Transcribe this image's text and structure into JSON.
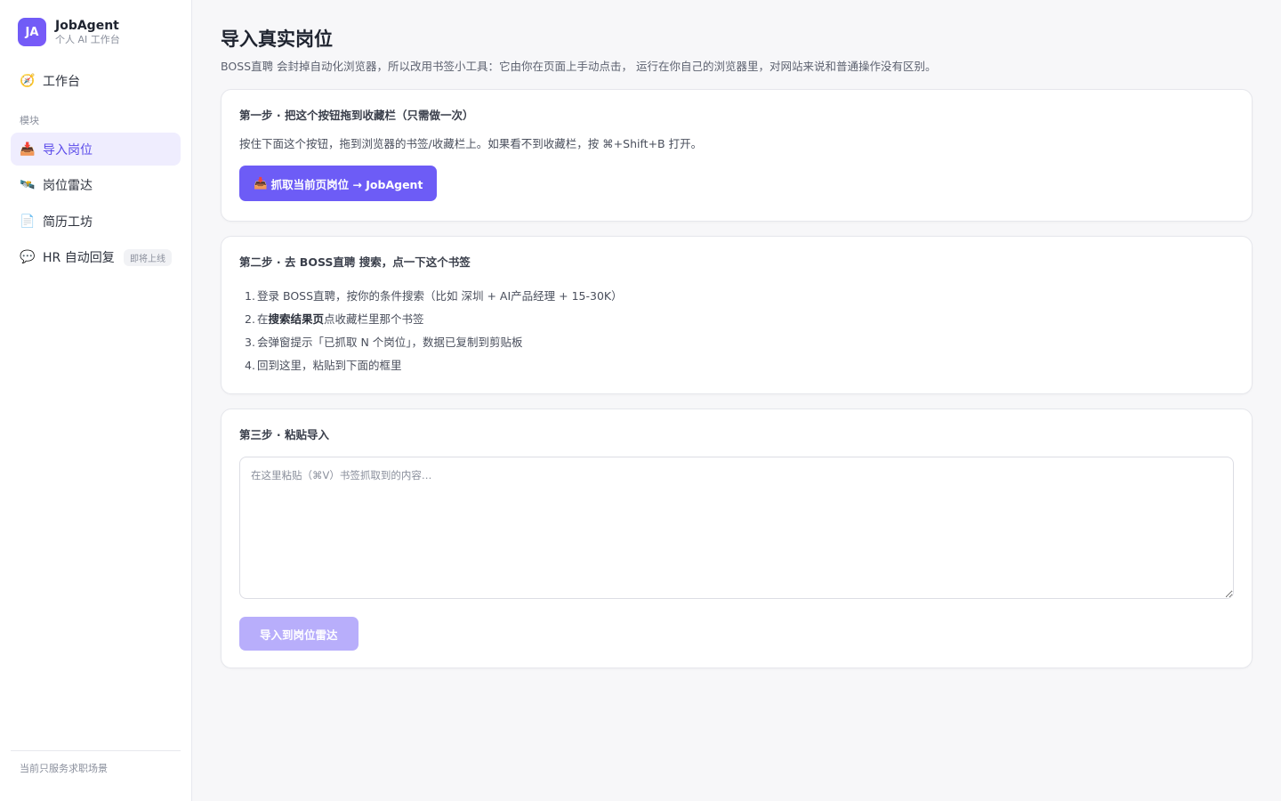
{
  "brand": {
    "logo": "JA",
    "name": "JobAgent",
    "subtitle": "个人 AI 工作台"
  },
  "nav": {
    "home": {
      "icon": "🧭",
      "label": "工作台"
    },
    "section_label": "模块",
    "items": [
      {
        "icon": "📥",
        "label": "导入岗位",
        "active": true
      },
      {
        "icon": "🛰️",
        "label": "岗位雷达"
      },
      {
        "icon": "📄",
        "label": "简历工坊"
      },
      {
        "icon": "💬",
        "label": "HR 自动回复",
        "badge": "即将上线"
      }
    ]
  },
  "sidebar_footer": "当前只服务求职场景",
  "page": {
    "title": "导入真实岗位",
    "description": "BOSS直聘 会封掉自动化浏览器，所以改用书签小工具：它由你在页面上手动点击， 运行在你自己的浏览器里，对网站来说和普通操作没有区别。"
  },
  "step1": {
    "title": "第一步 · 把这个按钮拖到收藏栏（只需做一次）",
    "text": "按住下面这个按钮，拖到浏览器的书签/收藏栏上。如果看不到收藏栏，按 ⌘+Shift+B 打开。",
    "button_icon": "📥",
    "button_label": "抓取当前页岗位 → JobAgent"
  },
  "step2": {
    "title": "第二步 · 去 BOSS直聘 搜索，点一下这个书签",
    "items": [
      {
        "num": "1.",
        "pre": "登录 BOSS直聘，按你的条件搜索（比如 深圳 + AI产品经理 + 15-30K）",
        "bold": "",
        "post": ""
      },
      {
        "num": "2.",
        "pre": "在",
        "bold": "搜索结果页",
        "post": "点收藏栏里那个书签"
      },
      {
        "num": "3.",
        "pre": "会弹窗提示「已抓取 N 个岗位」，数据已复制到剪贴板",
        "bold": "",
        "post": ""
      },
      {
        "num": "4.",
        "pre": "回到这里，粘贴到下面的框里",
        "bold": "",
        "post": ""
      }
    ]
  },
  "step3": {
    "title": "第三步 · 粘贴导入",
    "placeholder": "在这里粘贴（⌘V）书签抓取到的内容…",
    "value": "",
    "button_label": "导入到岗位雷达"
  },
  "colors": {
    "accent": "#6d5cf6",
    "accent_disabled": "#b8aefb",
    "active_bg": "#efedfe"
  }
}
